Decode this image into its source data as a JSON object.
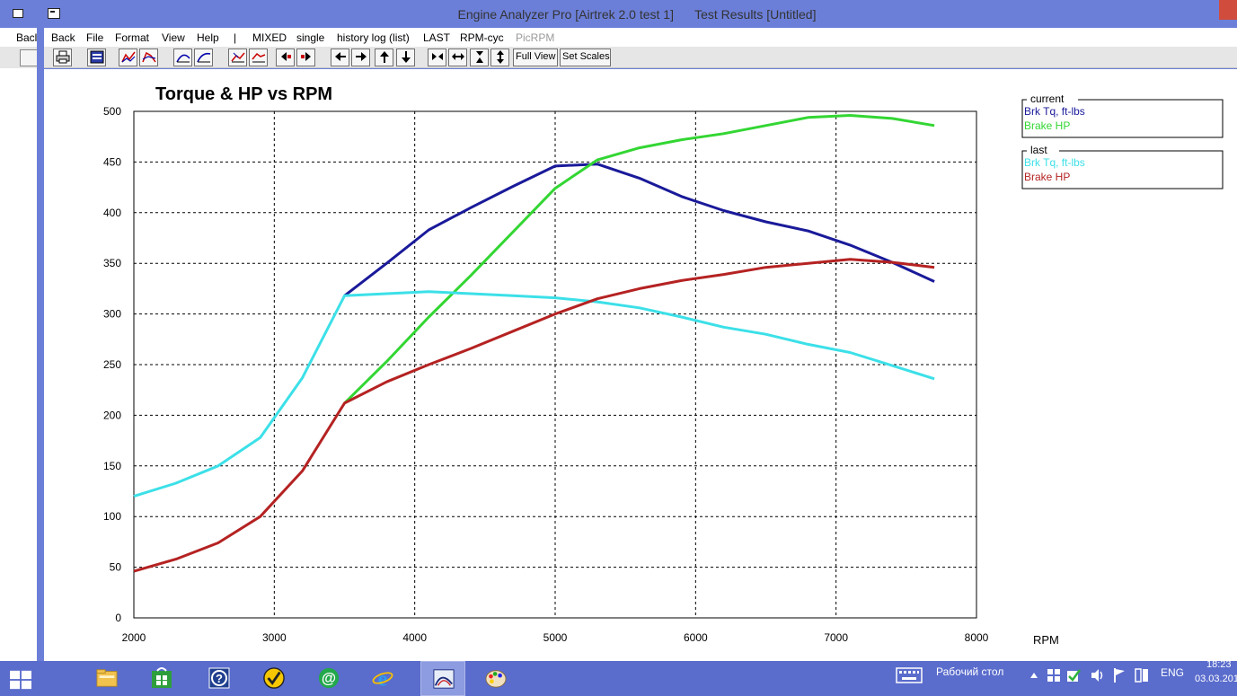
{
  "window": {
    "title": "Engine Analyzer Pro [Airtrek 2.0 test 1]      Test Results [Untitled]"
  },
  "background_window": {
    "menu_partial": "Bacl"
  },
  "menu": [
    {
      "label": "Back",
      "enabled": true
    },
    {
      "label": "File",
      "enabled": true
    },
    {
      "label": "Format",
      "enabled": true
    },
    {
      "label": "View",
      "enabled": true
    },
    {
      "label": "Help",
      "enabled": true
    },
    {
      "label": "|",
      "enabled": true
    },
    {
      "label": "MIXED",
      "enabled": true
    },
    {
      "label": "single",
      "enabled": true
    },
    {
      "label": "history log (list)",
      "enabled": true
    },
    {
      "label": "LAST",
      "enabled": true
    },
    {
      "label": "RPM-cyc",
      "enabled": true
    },
    {
      "label": "PicRPM",
      "enabled": false
    }
  ],
  "toolbar": {
    "icons": [
      "print-icon",
      "graph-window-icon",
      "chart-type-a-icon",
      "chart-type-b-icon",
      "curve-a-icon",
      "curve-b-icon",
      "plot-a-icon",
      "plot-b-icon",
      "shift-left-icon",
      "shift-right-icon",
      "arrow-left-icon",
      "arrow-right-icon",
      "arrow-up-icon",
      "arrow-down-icon",
      "compress-horizontal-icon",
      "expand-horizontal-icon",
      "compress-vertical-icon",
      "expand-vertical-icon"
    ],
    "full_view_label": "Full View",
    "set_scales_label": "Set Scales"
  },
  "chart_data": {
    "type": "line",
    "title": "Torque & HP vs RPM",
    "xlabel": "RPM",
    "ylabel": "",
    "xlim": [
      2000,
      8000
    ],
    "ylim": [
      0,
      500
    ],
    "x_ticks": [
      2000,
      3000,
      4000,
      5000,
      6000,
      7000,
      8000
    ],
    "y_ticks": [
      0,
      50,
      100,
      150,
      200,
      250,
      300,
      350,
      400,
      450,
      500
    ],
    "grid": true,
    "grid_style": "dashed",
    "legend_placement": "right",
    "legend_groups": [
      {
        "title": "current",
        "entries": [
          {
            "label": "Brk Tq, ft-lbs",
            "color": "#1a1a9a"
          },
          {
            "label": "Brake HP",
            "color": "#33d633"
          }
        ]
      },
      {
        "title": "last",
        "entries": [
          {
            "label": "Brk Tq, ft-lbs",
            "color": "#3ce0e8"
          },
          {
            "label": "Brake HP",
            "color": "#b52222"
          }
        ]
      }
    ],
    "series": [
      {
        "group": "current",
        "name": "Brk Tq, ft-lbs",
        "color": "#1a1a9a",
        "x": [
          3500,
          3800,
          4100,
          4400,
          4700,
          5000,
          5300,
          5600,
          5900,
          6200,
          6500,
          6800,
          7100,
          7400,
          7700
        ],
        "y": [
          318,
          350,
          383,
          405,
          426,
          446,
          448,
          434,
          416,
          402,
          391,
          382,
          368,
          351,
          332
        ]
      },
      {
        "group": "current",
        "name": "Brake HP",
        "color": "#33d633",
        "x": [
          3500,
          3800,
          4100,
          4400,
          4700,
          5000,
          5300,
          5600,
          5900,
          6200,
          6500,
          6800,
          7100,
          7400,
          7700
        ],
        "y": [
          212,
          253,
          297,
          338,
          381,
          424,
          452,
          464,
          472,
          478,
          486,
          494,
          496,
          493,
          486
        ]
      },
      {
        "group": "last",
        "name": "Brk Tq, ft-lbs",
        "color": "#3ce0e8",
        "x": [
          2000,
          2300,
          2600,
          2900,
          3200,
          3500,
          3800,
          4100,
          4400,
          4700,
          5000,
          5300,
          5600,
          5900,
          6200,
          6500,
          6800,
          7100,
          7400,
          7700
        ],
        "y": [
          120,
          133,
          150,
          178,
          237,
          318,
          320,
          322,
          320,
          318,
          316,
          312,
          306,
          297,
          287,
          280,
          270,
          262,
          249,
          236
        ]
      },
      {
        "group": "last",
        "name": "Brake HP",
        "color": "#b52222",
        "x": [
          2000,
          2300,
          2600,
          2900,
          3200,
          3500,
          3800,
          4100,
          4400,
          4700,
          5000,
          5300,
          5600,
          5900,
          6200,
          6500,
          6800,
          7100,
          7400,
          7700
        ],
        "y": [
          46,
          58,
          74,
          100,
          145,
          212,
          233,
          250,
          266,
          283,
          300,
          315,
          325,
          333,
          339,
          346,
          350,
          354,
          351,
          346
        ]
      }
    ]
  },
  "taskbar": {
    "items": [
      "start-icon",
      "file-explorer-icon",
      "store-icon",
      "help-icon",
      "norton-icon",
      "mail-icon",
      "internet-explorer-icon",
      "engine-analyzer-icon",
      "paint-icon"
    ],
    "desktop_label": "Рабочий стол",
    "language": "ENG",
    "time": "18:23",
    "date": "03.03.201"
  }
}
